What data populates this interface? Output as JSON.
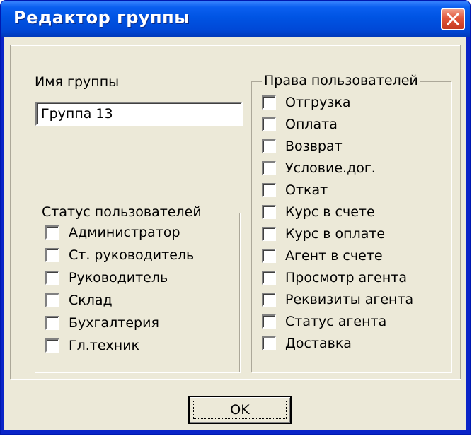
{
  "window": {
    "title": "Редактор группы"
  },
  "group_name": {
    "label": "Имя группы",
    "value": "Группа 13"
  },
  "user_status": {
    "title": "Статус пользователей",
    "items": [
      {
        "label": "Администратор",
        "checked": false
      },
      {
        "label": "Ст. руководитель",
        "checked": false
      },
      {
        "label": "Руководитель",
        "checked": false
      },
      {
        "label": "Склад",
        "checked": false
      },
      {
        "label": "Бухгалтерия",
        "checked": false
      },
      {
        "label": "Гл.техник",
        "checked": false
      }
    ]
  },
  "user_rights": {
    "title": "Права пользователей",
    "items": [
      {
        "label": "Отгрузка",
        "checked": false
      },
      {
        "label": "Оплата",
        "checked": false
      },
      {
        "label": "Возврат",
        "checked": false
      },
      {
        "label": "Условие.дог.",
        "checked": false
      },
      {
        "label": "Откат",
        "checked": false
      },
      {
        "label": "Курс в счете",
        "checked": false
      },
      {
        "label": "Курс в оплате",
        "checked": false
      },
      {
        "label": "Агент в счете",
        "checked": false
      },
      {
        "label": "Просмотр агента",
        "checked": false
      },
      {
        "label": "Реквизиты агента",
        "checked": false
      },
      {
        "label": "Статус агента",
        "checked": false
      },
      {
        "label": "Доставка",
        "checked": false
      }
    ]
  },
  "buttons": {
    "ok_label": "OK"
  },
  "colors": {
    "titlebar": "#0054e3",
    "client": "#ece9d8",
    "close": "#e2573b"
  }
}
